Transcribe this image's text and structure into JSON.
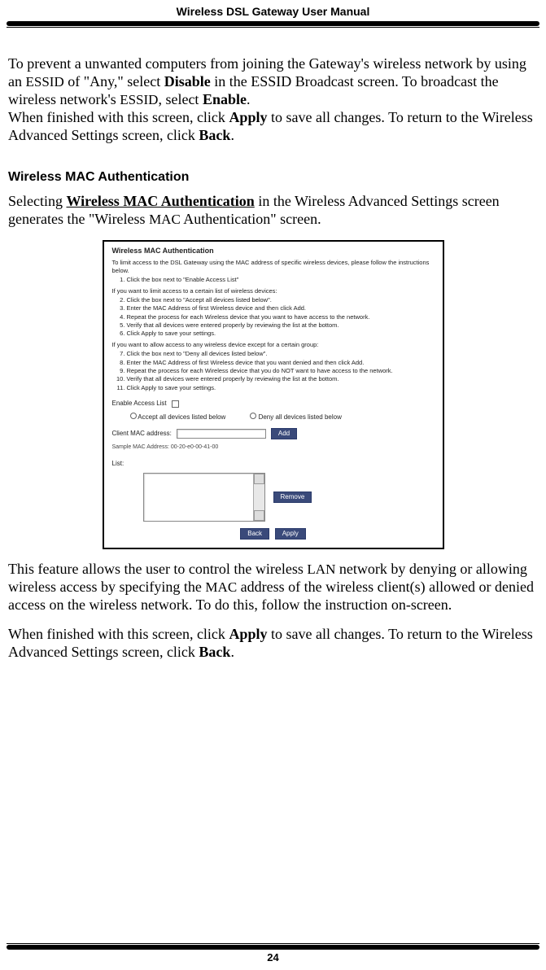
{
  "header": {
    "title": "Wireless DSL Gateway User Manual"
  },
  "footer": {
    "page": "24"
  },
  "p1": {
    "t1": "To prevent a unwanted computers from joining the Gateway's wireless network by using an ",
    "essid1": "ESSID",
    "t2": " of \"Any,\" select ",
    "disable": "Disable",
    "t3": " in the ESSID Broadcast screen. To broadcast the wireless network's ",
    "essid2": "ESSID",
    "t4": ", select ",
    "enable": "Enable",
    "t5": "."
  },
  "p2": {
    "t1": "When finished with this screen, click ",
    "apply": "Apply",
    "t2": " to save all changes. To return to the Wireless Advanced Settings screen, click ",
    "back": "Back",
    "t3": "."
  },
  "section_heading": "Wireless MAC Authentication",
  "p3": {
    "t1": "Selecting ",
    "link": "Wireless MAC Authentication",
    "t2": " in the Wireless Advanced Settings screen generates the \"Wireless ",
    "mac": "MAC",
    "t3": " Authentication\" screen."
  },
  "screenshot": {
    "title": "Wireless MAC Authentication",
    "intro": "To limit access to the DSL Gateway using the MAC address of specific wireless devices, please follow the instructions below.",
    "step1": "Click the box next to \"Enable Access List\"",
    "grpA_intro": "If you want to limit access to a certain list of wireless devices:",
    "grpA": [
      "Click the box next to \"Accept all devices listed below\".",
      "Enter the MAC Address of first Wireless device and then click Add.",
      "Repeat the process for each Wireless device that you want to have access to the network.",
      "Verify that all devices were entered properly by reviewing the list at the bottom.",
      "Click Apply to save your settings."
    ],
    "grpB_intro": "If you want to allow access to any wireless device except for a certain group:",
    "grpB": [
      "Click the box next to \"Deny all devices listed below\".",
      "Enter the MAC Address of first Wireless device that you want denied and then click Add.",
      "Repeat the process for each Wireless device that you do NOT want to have access to the network.",
      "Verify that all devices were entered properly by reviewing the list at the bottom.",
      "Click Apply to save your settings."
    ],
    "enable_label": "Enable Access List",
    "radio_accept": "Accept all devices listed below",
    "radio_deny": "Deny all devices listed below",
    "mac_label": "Client MAC address:",
    "add_btn": "Add",
    "sample": "Sample MAC Address: 00-20-e0-00-41-00",
    "list_label": "List:",
    "remove_btn": "Remove",
    "back_btn": "Back",
    "apply_btn": "Apply"
  },
  "p4": {
    "t1": "This feature allows the user to control the wireless ",
    "lan": "LAN",
    "t2": " network by denying or allowing wireless access by specifying the ",
    "mac": "MAC",
    "t3": " address of the wireless client(s) allowed or denied access on the wireless network. To do this, follow the instruction on-screen."
  },
  "p5": {
    "t1": "When finished with this screen, click ",
    "apply": "Apply",
    "t2": " to save all changes. To return to the Wireless Advanced Settings screen, click ",
    "back": "Back",
    "t3": "."
  }
}
